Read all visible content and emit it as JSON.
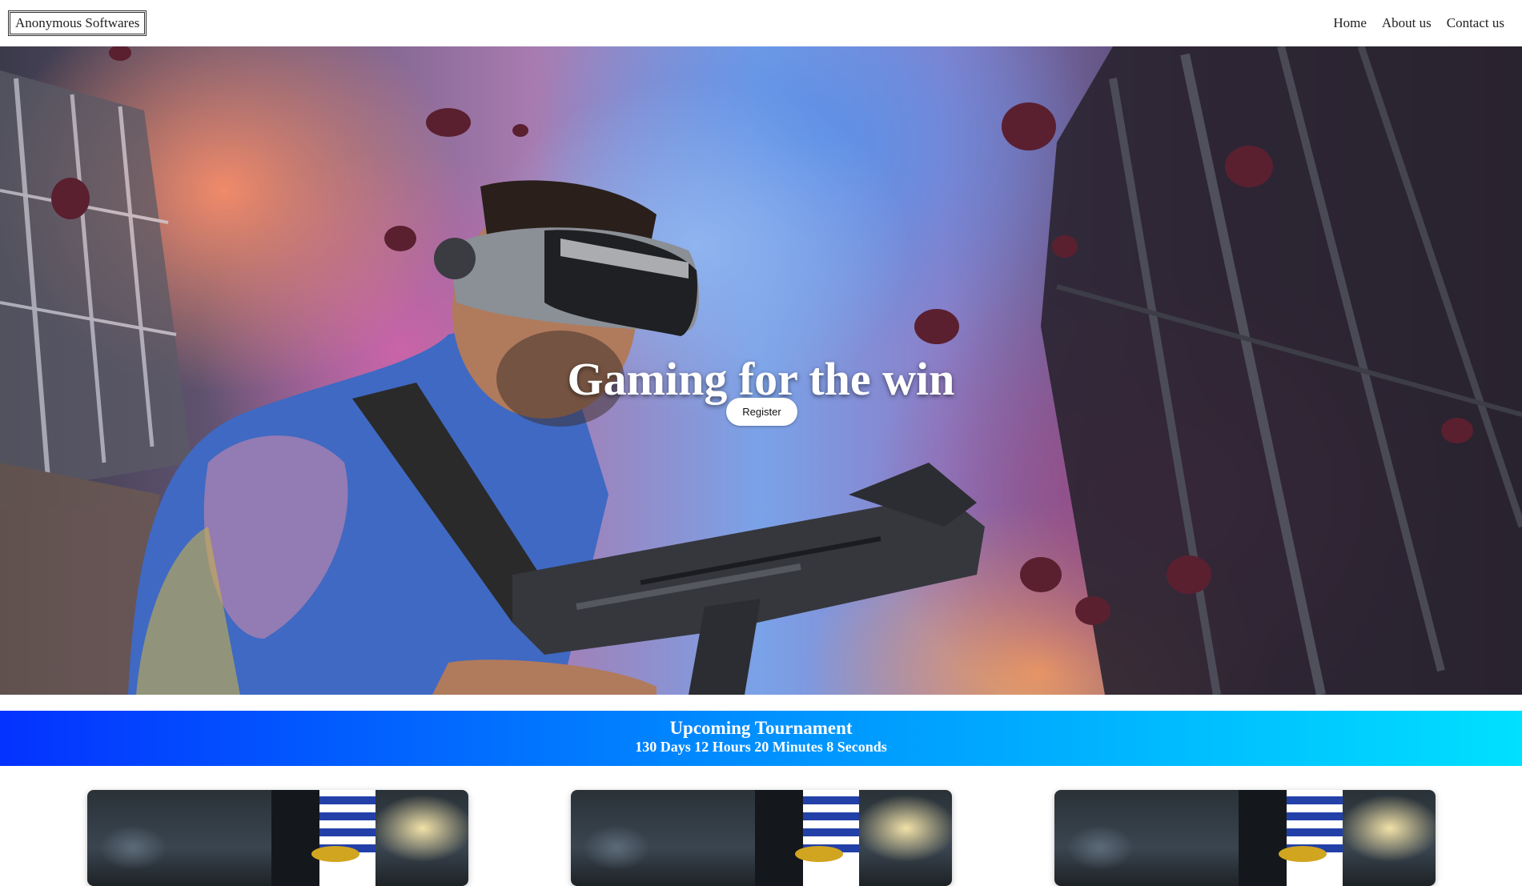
{
  "navbar": {
    "brand": "Anonymous Softwares",
    "links": [
      "Home",
      "About us",
      "Contact us"
    ]
  },
  "hero": {
    "title": "Gaming for the win",
    "register_label": "Register"
  },
  "tournament": {
    "title": "Upcoming Tournament",
    "countdown": "130 Days 12 Hours 20 Minutes 8 Seconds"
  },
  "colors": {
    "banner_start": "#0432ff",
    "banner_mid": "#0090ff",
    "banner_end": "#00e0ff"
  }
}
